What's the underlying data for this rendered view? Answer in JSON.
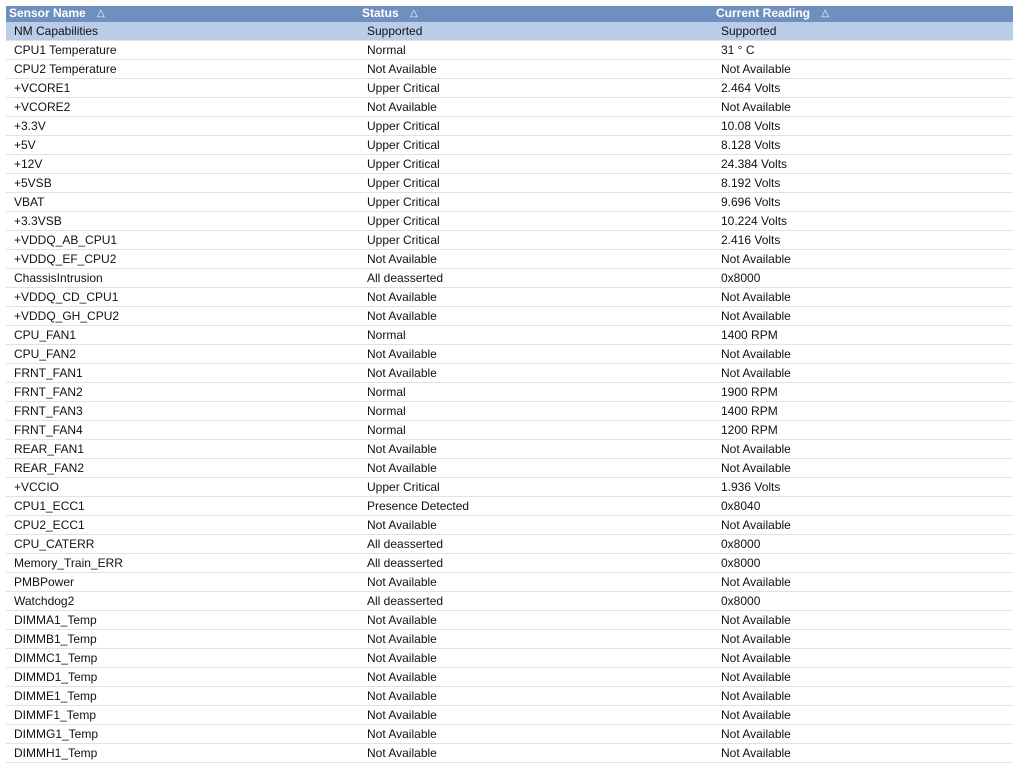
{
  "headers": [
    "Sensor Name",
    "Status",
    "Current Reading"
  ],
  "sort_icon_glyph": "△",
  "rows": [
    {
      "name": "NM Capabilities",
      "status": "Supported",
      "reading": "Supported"
    },
    {
      "name": "CPU1 Temperature",
      "status": "Normal",
      "reading": "31 ° C"
    },
    {
      "name": "CPU2 Temperature",
      "status": "Not Available",
      "reading": "Not Available"
    },
    {
      "name": "+VCORE1",
      "status": "Upper Critical",
      "reading": "2.464 Volts"
    },
    {
      "name": "+VCORE2",
      "status": "Not Available",
      "reading": "Not Available"
    },
    {
      "name": "+3.3V",
      "status": "Upper Critical",
      "reading": "10.08 Volts"
    },
    {
      "name": "+5V",
      "status": "Upper Critical",
      "reading": "8.128 Volts"
    },
    {
      "name": "+12V",
      "status": "Upper Critical",
      "reading": "24.384 Volts"
    },
    {
      "name": "+5VSB",
      "status": "Upper Critical",
      "reading": "8.192 Volts"
    },
    {
      "name": "VBAT",
      "status": "Upper Critical",
      "reading": "9.696 Volts"
    },
    {
      "name": "+3.3VSB",
      "status": "Upper Critical",
      "reading": "10.224 Volts"
    },
    {
      "name": "+VDDQ_AB_CPU1",
      "status": "Upper Critical",
      "reading": "2.416 Volts"
    },
    {
      "name": "+VDDQ_EF_CPU2",
      "status": "Not Available",
      "reading": "Not Available"
    },
    {
      "name": "ChassisIntrusion",
      "status": "All deasserted",
      "reading": "0x8000"
    },
    {
      "name": "+VDDQ_CD_CPU1",
      "status": "Not Available",
      "reading": "Not Available"
    },
    {
      "name": "+VDDQ_GH_CPU2",
      "status": "Not Available",
      "reading": "Not Available"
    },
    {
      "name": "CPU_FAN1",
      "status": "Normal",
      "reading": "1400 RPM"
    },
    {
      "name": "CPU_FAN2",
      "status": "Not Available",
      "reading": "Not Available"
    },
    {
      "name": "FRNT_FAN1",
      "status": "Not Available",
      "reading": "Not Available"
    },
    {
      "name": "FRNT_FAN2",
      "status": "Normal",
      "reading": "1900 RPM"
    },
    {
      "name": "FRNT_FAN3",
      "status": "Normal",
      "reading": "1400 RPM"
    },
    {
      "name": "FRNT_FAN4",
      "status": "Normal",
      "reading": "1200 RPM"
    },
    {
      "name": "REAR_FAN1",
      "status": "Not Available",
      "reading": "Not Available"
    },
    {
      "name": "REAR_FAN2",
      "status": "Not Available",
      "reading": "Not Available"
    },
    {
      "name": "+VCCIO",
      "status": "Upper Critical",
      "reading": "1.936 Volts"
    },
    {
      "name": "CPU1_ECC1",
      "status": "Presence Detected",
      "reading": "0x8040"
    },
    {
      "name": "CPU2_ECC1",
      "status": "Not Available",
      "reading": "Not Available"
    },
    {
      "name": "CPU_CATERR",
      "status": "All deasserted",
      "reading": "0x8000"
    },
    {
      "name": "Memory_Train_ERR",
      "status": "All deasserted",
      "reading": "0x8000"
    },
    {
      "name": "PMBPower",
      "status": "Not Available",
      "reading": "Not Available"
    },
    {
      "name": "Watchdog2",
      "status": "All deasserted",
      "reading": "0x8000"
    },
    {
      "name": "DIMMA1_Temp",
      "status": "Not Available",
      "reading": "Not Available"
    },
    {
      "name": "DIMMB1_Temp",
      "status": "Not Available",
      "reading": "Not Available"
    },
    {
      "name": "DIMMC1_Temp",
      "status": "Not Available",
      "reading": "Not Available"
    },
    {
      "name": "DIMMD1_Temp",
      "status": "Not Available",
      "reading": "Not Available"
    },
    {
      "name": "DIMME1_Temp",
      "status": "Not Available",
      "reading": "Not Available"
    },
    {
      "name": "DIMMF1_Temp",
      "status": "Not Available",
      "reading": "Not Available"
    },
    {
      "name": "DIMMG1_Temp",
      "status": "Not Available",
      "reading": "Not Available"
    },
    {
      "name": "DIMMH1_Temp",
      "status": "Not Available",
      "reading": "Not Available"
    }
  ],
  "colors": {
    "header_bg": "#6f8fbf",
    "highlight_row_bg": "#b9cde8",
    "row_border": "#e2e2e2"
  }
}
